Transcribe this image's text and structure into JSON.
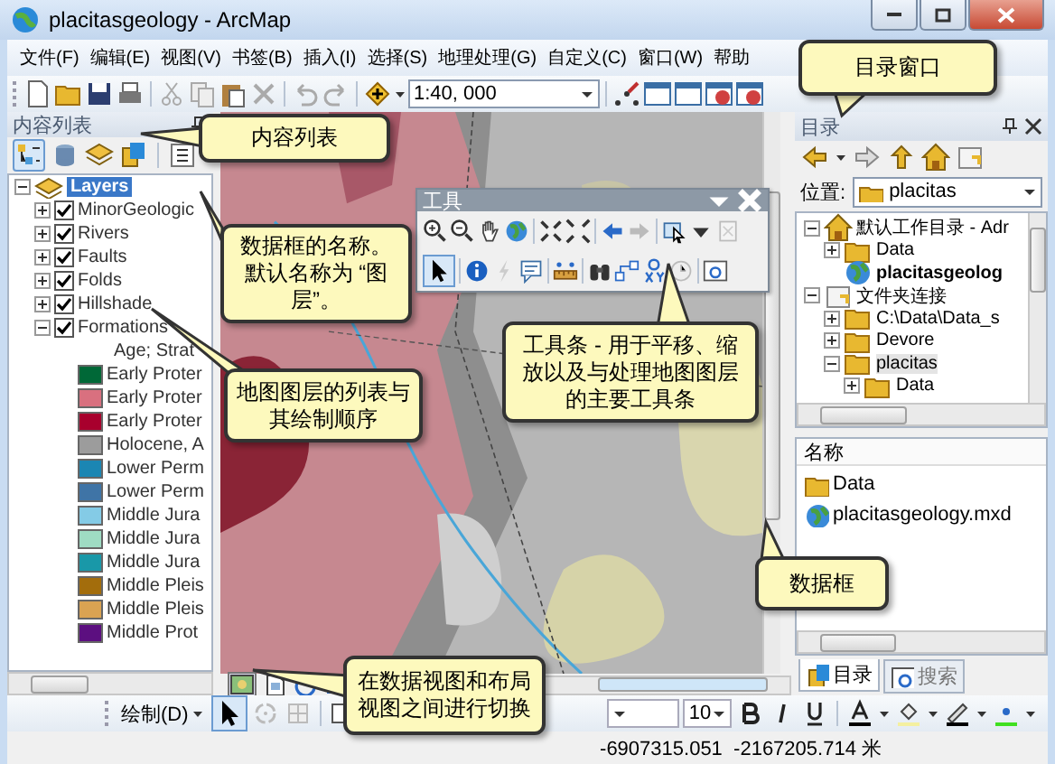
{
  "window": {
    "title": "placitasgeology - ArcMap"
  },
  "menu": [
    "文件(F)",
    "编辑(E)",
    "视图(V)",
    "书签(B)",
    "插入(I)",
    "选择(S)",
    "地理处理(G)",
    "自定义(C)",
    "窗口(W)",
    "帮助"
  ],
  "toolbar": {
    "scale": "1:40, 000"
  },
  "toc": {
    "title": "内容列表",
    "data_frame": {
      "label": "Layers",
      "selected": true,
      "expanded": true
    },
    "layers": [
      {
        "name": "MinorGeologic",
        "checked": true,
        "expanded": false
      },
      {
        "name": "Rivers",
        "checked": true,
        "expanded": false
      },
      {
        "name": "Faults",
        "checked": true,
        "expanded": false
      },
      {
        "name": "Folds",
        "checked": true,
        "expanded": false
      },
      {
        "name": "Hillshade",
        "checked": true,
        "expanded": false
      },
      {
        "name": "Formations",
        "checked": true,
        "expanded": true,
        "heading": "Age; Strat",
        "legend": [
          {
            "label": "Early Proter",
            "color": "#006837"
          },
          {
            "label": "Early Proter",
            "color": "#d9707f"
          },
          {
            "label": "Early Proter",
            "color": "#a8002d"
          },
          {
            "label": "Holocene, A",
            "color": "#9c9c9c"
          },
          {
            "label": "Lower Perm",
            "color": "#1b86b3"
          },
          {
            "label": "Lower Perm",
            "color": "#3f74a6"
          },
          {
            "label": "Middle Jura",
            "color": "#84cbe6"
          },
          {
            "label": "Middle Jura",
            "color": "#9fdcc3"
          },
          {
            "label": "Middle Jura",
            "color": "#1998a8"
          },
          {
            "label": "Middle Pleis",
            "color": "#a36d0c"
          },
          {
            "label": "Middle Pleis",
            "color": "#daa352"
          },
          {
            "label": "Middle Prot",
            "color": "#5c0f80"
          }
        ]
      }
    ]
  },
  "tools_window": {
    "title": "工具"
  },
  "catalog": {
    "title": "目录",
    "location_label": "位置:",
    "location": "placitas",
    "tree": [
      {
        "label": "默认工作目录 - Adr",
        "kind": "home",
        "expanded": true,
        "selected": false,
        "children": [
          {
            "label": "Data",
            "kind": "folder",
            "expanded": false,
            "selected": false
          },
          {
            "label": "placitasgeolog",
            "kind": "map",
            "selected": false
          }
        ]
      },
      {
        "label": "文件夹连接",
        "kind": "connections",
        "expanded": true,
        "selected": false,
        "children": [
          {
            "label": "C:\\Data\\Data_s",
            "kind": "folder",
            "expanded": false,
            "selected": false
          },
          {
            "label": "Devore",
            "kind": "folder",
            "expanded": false,
            "selected": false
          },
          {
            "label": "placitas",
            "kind": "folder",
            "expanded": true,
            "selected": true,
            "children": [
              {
                "label": "Data",
                "kind": "folder",
                "expanded": false,
                "selected": false
              }
            ]
          }
        ]
      }
    ],
    "contents_header": "名称",
    "contents": [
      {
        "label": "Data",
        "kind": "folder"
      },
      {
        "label": "placitasgeology.mxd",
        "kind": "map"
      }
    ],
    "tabs": [
      {
        "label": "目录",
        "selected": true
      },
      {
        "label": "搜索",
        "selected": false
      }
    ]
  },
  "draw_toolbar": {
    "menu": "绘制(D)",
    "font_size": "10"
  },
  "status_bar": {
    "coordinates": "-6907315.051  -2167205.714 米"
  },
  "callouts": [
    {
      "text": "目录窗口"
    },
    {
      "text": "内容列表"
    },
    {
      "text": "数据框的名称。默认名称为 “图层”。"
    },
    {
      "text": "地图图层的列表与其绘制顺序"
    },
    {
      "text": "工具条 - 用于平移、缩放以及与处理地图图层的主要工具条"
    },
    {
      "text": "数据框"
    },
    {
      "text": "在数据视图和布局视图之间进行切换"
    }
  ]
}
